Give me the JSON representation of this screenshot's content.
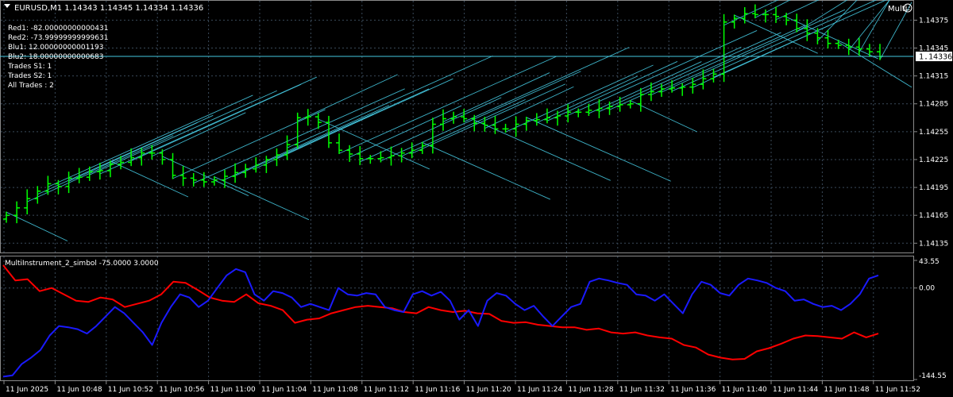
{
  "window": {
    "symbol_line": "EURUSD,M1  1.14343 1.14345 1.14334 1.14336",
    "multi_label": "Multi",
    "multi_icon": "smiley-icon"
  },
  "info": [
    "Red1: -82.00000000000431",
    "Red2: -73.99999999999631",
    "Blu1: 12.00000000001193",
    "Blu2: 18.00000000000683",
    "Trades S1: 1",
    "Trades S2: 1",
    "All Trades : 2"
  ],
  "indicator_label": "MultiInstrument_2_simbol -75.0000 3.0000",
  "colors": {
    "background": "#000000",
    "grid": "#3a4a5a",
    "candle": "#00ff00",
    "trend": "#45c8e0",
    "red_line": "#ff0000",
    "blue_line": "#1a1aff",
    "axis_text": "#ffffff",
    "price_tag_bg": "#ffffff",
    "price_tag_text": "#000000"
  },
  "chart_data": [
    {
      "type": "candlestick",
      "symbol": "EURUSD",
      "timeframe": "M1",
      "ylim": [
        1.14125,
        1.14395
      ],
      "y_ticks": [
        "1.14375",
        "1.14345",
        "1.14315",
        "1.14285",
        "1.14255",
        "1.14225",
        "1.14195",
        "1.14165",
        "1.14135"
      ],
      "current_price": "1.14336",
      "grid": true,
      "close": [
        1.14165,
        1.14173,
        1.14183,
        1.14191,
        1.14199,
        1.14196,
        1.14205,
        1.14206,
        1.14212,
        1.14213,
        1.1422,
        1.14222,
        1.14227,
        1.14232,
        1.14232,
        1.14225,
        1.14208,
        1.14205,
        1.14203,
        1.14201,
        1.14203,
        1.14207,
        1.14211,
        1.14215,
        1.14219,
        1.14225,
        1.1423,
        1.14241,
        1.1427,
        1.14271,
        1.14265,
        1.14243,
        1.14235,
        1.14231,
        1.14226,
        1.14226,
        1.14227,
        1.14229,
        1.14232,
        1.14235,
        1.1424,
        1.14263,
        1.14269,
        1.14271,
        1.14269,
        1.14264,
        1.14262,
        1.14258,
        1.14258,
        1.14263,
        1.14267,
        1.14268,
        1.1427,
        1.14272,
        1.14276,
        1.14276,
        1.14278,
        1.1428,
        1.14282,
        1.14284,
        1.14285,
        1.14295,
        1.14298,
        1.14301,
        1.14302,
        1.14303,
        1.14306,
        1.14312,
        1.14317,
        1.14373,
        1.14377,
        1.14382,
        1.14381,
        1.14381,
        1.14379,
        1.14375,
        1.14366,
        1.14361,
        1.14356,
        1.1435,
        1.14348,
        1.14346,
        1.14344,
        1.14341,
        1.14336
      ],
      "x_ticks": [
        "11 Jun 2025",
        "11 Jun 10:48",
        "11 Jun 10:52",
        "11 Jun 10:56",
        "11 Jun 11:00",
        "11 Jun 11:04",
        "11 Jun 11:08",
        "11 Jun 11:12",
        "11 Jun 11:16",
        "11 Jun 11:20",
        "11 Jun 11:24",
        "11 Jun 11:28",
        "11 Jun 11:32",
        "11 Jun 11:36",
        "11 Jun 11:40",
        "11 Jun 11:44",
        "11 Jun 11:48",
        "11 Jun 11:52"
      ]
    },
    {
      "type": "line",
      "title": "MultiInstrument_2_simbol -75.0000 3.0000",
      "ylim": [
        -144.55,
        43.55
      ],
      "y_ticks": [
        "43.55",
        "0.00",
        "-144.55"
      ],
      "series": [
        {
          "name": "",
          "color": "#ff0000",
          "values": [
            36,
            12,
            14,
            -5,
            0,
            -10,
            -20,
            -22,
            -15,
            -18,
            -30,
            -25,
            -20,
            -10,
            10,
            8,
            -3,
            -15,
            -20,
            -22,
            -10,
            -24,
            -28,
            -35,
            -55,
            -50,
            -48,
            -40,
            -35,
            -30,
            -28,
            -30,
            -32,
            -38,
            -40,
            -30,
            -35,
            -38,
            -36,
            -40,
            -41,
            -52,
            -55,
            -54,
            -58,
            -60,
            -62,
            -62,
            -66,
            -64,
            -70,
            -72,
            -70,
            -75,
            -78,
            -80,
            -90,
            -94,
            -105,
            -110,
            -113,
            -112,
            -100,
            -95,
            -88,
            -80,
            -75,
            -76,
            -78,
            -80,
            -70,
            -78,
            -72
          ]
        },
        {
          "name": "",
          "color": "#1a1aff",
          "values": [
            -140,
            -138,
            -120,
            -110,
            -98,
            -75,
            -60,
            -62,
            -65,
            -72,
            -60,
            -45,
            -30,
            -40,
            -55,
            -70,
            -90,
            -55,
            -30,
            -10,
            -15,
            -30,
            -20,
            0,
            20,
            30,
            25,
            -10,
            -20,
            -5,
            -8,
            -15,
            -30,
            -25,
            -30,
            -35,
            0,
            -10,
            -12,
            -8,
            -10,
            -30,
            -35,
            -38,
            -10,
            -5,
            -12,
            -6,
            -20,
            -50,
            -35,
            -60,
            -20,
            -8,
            -12,
            -25,
            -35,
            -28,
            -45,
            -60,
            -45,
            -30,
            -25,
            10,
            15,
            12,
            8,
            5,
            -10,
            -12,
            -20,
            -10,
            -25,
            -40,
            -10,
            10,
            5,
            -8,
            -12,
            5,
            15,
            12,
            8,
            0,
            -5,
            -20,
            -18,
            -25,
            -30,
            -28,
            -35,
            -25,
            -10,
            15,
            20
          ]
        }
      ]
    }
  ]
}
